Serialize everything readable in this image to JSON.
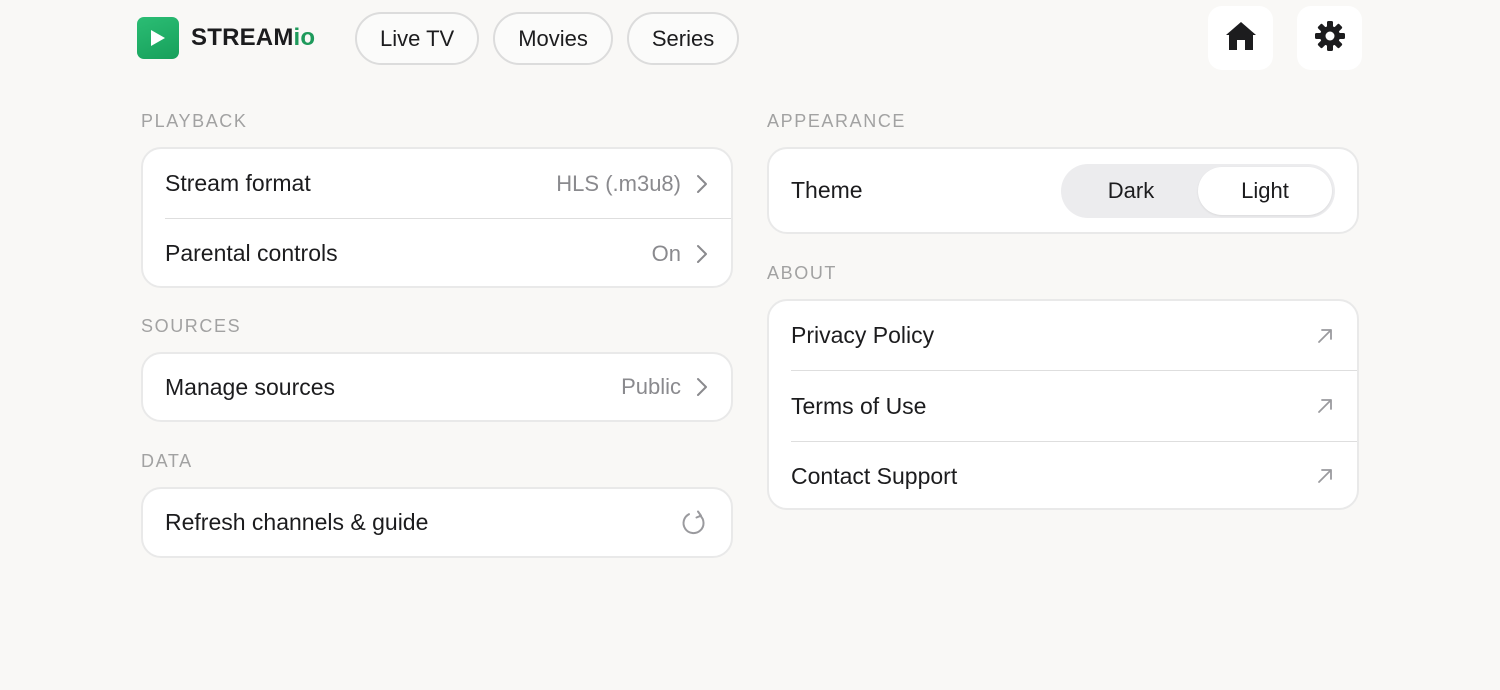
{
  "brand": {
    "name_main": "STREAM",
    "name_accent": "io",
    "accent_color": "#1e9a5b"
  },
  "nav": [
    {
      "label": "Live TV"
    },
    {
      "label": "Movies"
    },
    {
      "label": "Series"
    }
  ],
  "toolbar": {
    "home_icon": "home-icon",
    "settings_icon": "gear-icon"
  },
  "playback": {
    "title": "PLAYBACK",
    "rows": [
      {
        "label": "Stream format",
        "value": "HLS (.m3u8)"
      },
      {
        "label": "Parental controls",
        "value": "On"
      }
    ]
  },
  "sources": {
    "title": "SOURCES",
    "rows": [
      {
        "label": "Manage sources",
        "value": "Public"
      }
    ]
  },
  "data_section": {
    "title": "DATA",
    "rows": [
      {
        "label": "Refresh channels & guide",
        "icon": "refresh-icon"
      }
    ]
  },
  "appearance": {
    "title": "APPEARANCE",
    "theme_label": "Theme",
    "options": [
      {
        "label": "Dark"
      },
      {
        "label": "Light"
      }
    ],
    "selected": "Light"
  },
  "about": {
    "title": "ABOUT",
    "rows": [
      {
        "label": "Privacy Policy"
      },
      {
        "label": "Terms of Use"
      },
      {
        "label": "Contact Support"
      }
    ]
  }
}
